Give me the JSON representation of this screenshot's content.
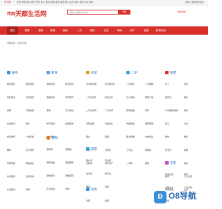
{
  "topbar": {
    "city": "♥ 河南",
    "links": "长葛 洋阳 新乡 尉氏 开封 栾川 渑池 新野 延津 宜阳 伊川 孟津 镇平 淮阳 扶沟 通许",
    "right": "登录 | 免费发布信息"
  },
  "header": {
    "logo_mark": "传网",
    "site_name": "天都生活网",
    "search_placeholder": "请输入你要找的信息",
    "search_button": "搜索",
    "post_button": "免费发布"
  },
  "nav": {
    "items": [
      {
        "label": "首页"
      },
      {
        "label": "招聘"
      },
      {
        "label": "服务"
      },
      {
        "label": "教育"
      },
      {
        "label": "家政"
      },
      {
        "label": "二手"
      },
      {
        "label": "宠物"
      },
      {
        "label": "交友"
      },
      {
        "label": "车辆"
      },
      {
        "label": "房产"
      },
      {
        "label": "旅游"
      },
      {
        "label": "教育培训"
      }
    ]
  },
  "breadcrumb": "当前位置 > 信息分类",
  "categories": [
    {
      "title": "服务",
      "color": "#3a8fd9",
      "items": [
        "婚庆摄影",
        "搬家搬运",
        "家政保洁",
        "管道疏通",
        "保姆",
        "开锁换锁",
        "快递物流",
        "租车",
        "鲜花婚庆",
        "广告传媒",
        "翻译",
        "设计策划",
        "印刷包装",
        "网站建设",
        "商务服务",
        "法律咨询",
        "生活配送",
        "律师",
        "家电维修",
        "电脑维修"
      ]
    },
    {
      "title": "教育",
      "color": "#5aa0e6",
      "items": [
        "语言培训",
        "职业培训",
        "电脑培训",
        "学历教育",
        "家教",
        "艺术培训",
        "体育培训",
        "出国留学",
        "设计培训",
        "会计培训",
        "驾校",
        "IT培训",
        "留学"
      ]
    },
    {
      "title": "房屋",
      "color": "#e0a21b",
      "items": [
        "写字楼出租",
        "写字楼出售",
        "二手房出售",
        "新房出售",
        "二手房求购",
        "厂房仓库",
        "商铺出租",
        "商铺出售",
        "租房",
        "短租",
        "求租",
        "日租房",
        "合租房",
        "海外地产"
      ]
    },
    {
      "title": "二手",
      "color": "#3aa0d9",
      "items": [
        "二手手机",
        "二手电脑",
        "办公用品",
        "数码产品",
        "家用电器",
        "家具",
        "母婴用品",
        "服装鞋帽",
        "图书音像",
        "文体用品",
        "工艺品",
        "收藏品",
        "二手车",
        "其他"
      ]
    },
    {
      "title": "招聘",
      "color": "#d9302c",
      "items": [
        "普工",
        "司机",
        "服务员",
        "销售",
        "汽车美容/维修",
        "保安",
        "技工",
        "文员",
        "财务",
        "物流",
        "营业员",
        "客服",
        "厨师",
        "保洁",
        "教师",
        "人力资源",
        "美容美发",
        "主播"
      ]
    },
    {
      "title": "宠物",
      "color": "#e07b1b",
      "items": [
        "宠物狗",
        "宠物猫",
        "宠物用品",
        "宠物服务",
        "宠物寄养",
        "宠物医院",
        "花鸟鱼虫",
        "水族"
      ]
    },
    {
      "title": "旅游",
      "color": "#3aa0d9",
      "items": [
        "国内游",
        "周边游",
        "出境游",
        "旅行社",
        "酒店",
        "机票",
        "签证",
        "门票"
      ]
    },
    {
      "title": "交友",
      "color": "#c04fbf",
      "items": [
        "同城交友",
        "婚恋",
        "兴趣交友",
        "户外活动",
        "聚会"
      ]
    },
    {
      "title": "商务",
      "color": "#3a8fd9",
      "items": [
        "代理",
        "加盟",
        "批发",
        "投资",
        "招商",
        "转让"
      ]
    }
  ],
  "watermark": {
    "mark": "D",
    "text": "O8导航"
  }
}
